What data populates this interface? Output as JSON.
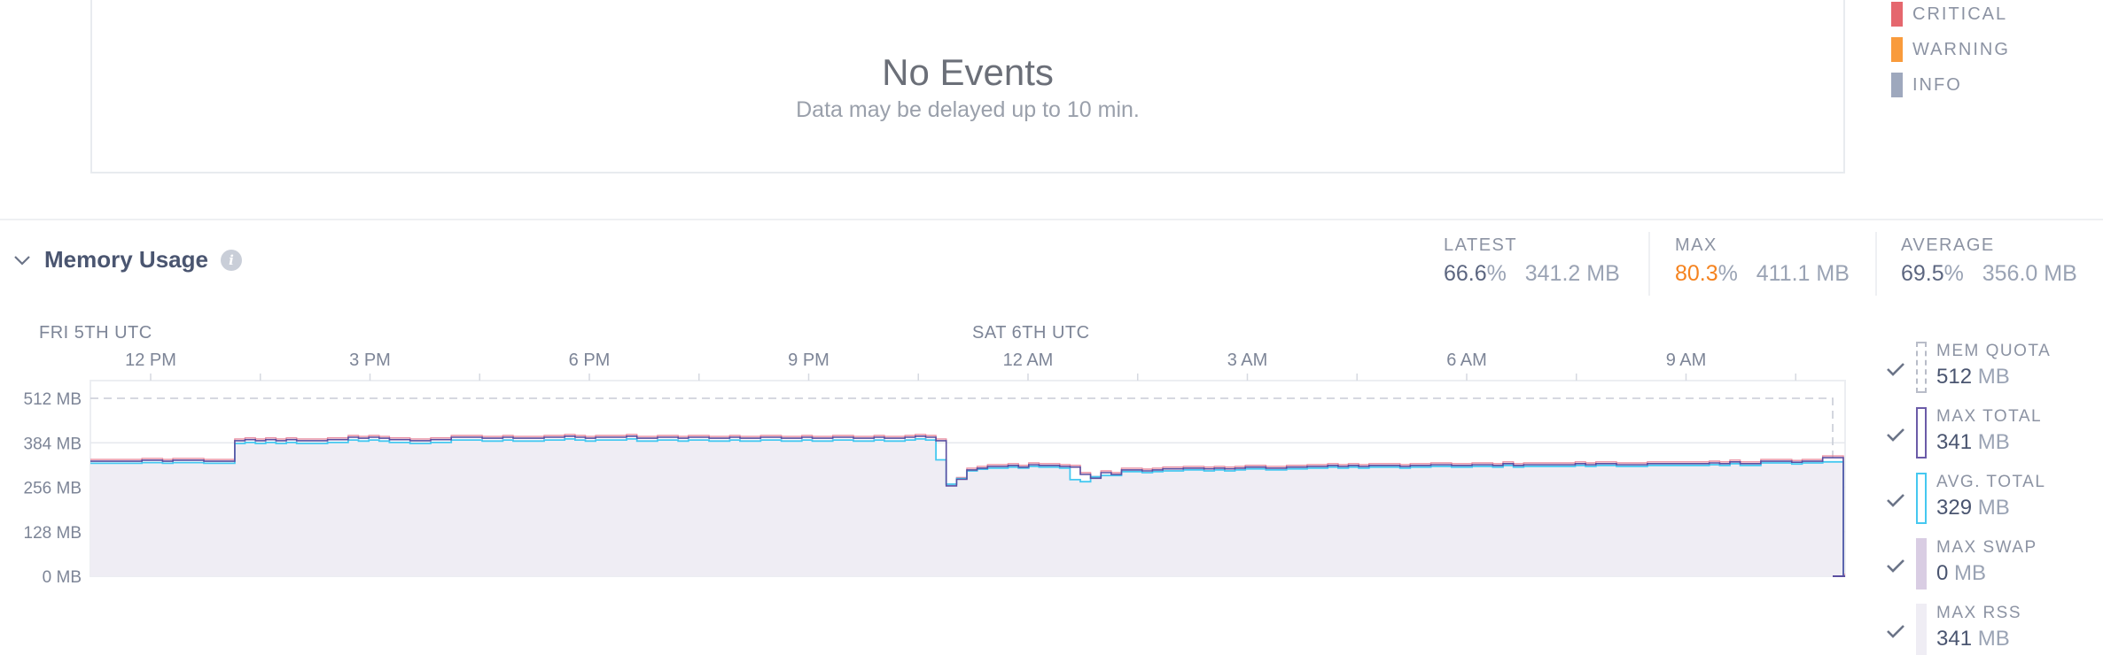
{
  "events": {
    "title": "No Events",
    "subtitle": "Data may be delayed up to 10 min."
  },
  "severity_legend": [
    {
      "label": "CRITICAL",
      "color": "#e5676e"
    },
    {
      "label": "WARNING",
      "color": "#f99b3c"
    },
    {
      "label": "INFO",
      "color": "#9ea8bd"
    }
  ],
  "section": {
    "title": "Memory Usage",
    "info_icon": "i"
  },
  "stats": {
    "latest": {
      "label": "LATEST",
      "pct": "66.6",
      "pct_unit": "%",
      "mb": "341.2 MB"
    },
    "max": {
      "label": "MAX",
      "pct": "80.3",
      "pct_unit": "%",
      "mb": "411.1 MB"
    },
    "average": {
      "label": "AVERAGE",
      "pct": "69.5",
      "pct_unit": "%",
      "mb": "356.0 MB"
    }
  },
  "chart_data": {
    "type": "line",
    "title": "Memory Usage",
    "date_labels": [
      "FRI 5TH UTC",
      "SAT 6TH UTC"
    ],
    "x_tick_labels": [
      "12 PM",
      "3 PM",
      "6 PM",
      "9 PM",
      "12 AM",
      "3 AM",
      "6 AM",
      "9 AM"
    ],
    "y_tick_labels": [
      "512 MB",
      "384 MB",
      "256 MB",
      "128 MB",
      "0 MB"
    ],
    "ylim": [
      0,
      512
    ],
    "x_start": "Fri 10:36",
    "x_step_minutes": 20,
    "grid": true,
    "series": [
      {
        "name": "MEM QUOTA",
        "style": "dashed",
        "color": "#b8bcc8",
        "values": [
          512
        ]
      },
      {
        "name": "MAX TOTAL",
        "color": "#6b5ba8",
        "values": [
          331,
          331,
          331,
          331,
          331,
          334,
          334,
          331,
          334,
          334,
          334,
          331,
          331,
          331,
          390,
          393,
          390,
          393,
          390,
          393,
          390,
          390,
          390,
          393,
          393,
          400,
          397,
          400,
          397,
          393,
          393,
          390,
          390,
          393,
          393,
          400,
          400,
          400,
          397,
          397,
          400,
          397,
          397,
          397,
          400,
          400,
          403,
          400,
          397,
          400,
          400,
          400,
          403,
          397,
          397,
          400,
          400,
          397,
          400,
          400,
          397,
          397,
          400,
          397,
          397,
          400,
          400,
          397,
          397,
          400,
          397,
          397,
          400,
          400,
          397,
          397,
          400,
          397,
          397,
          400,
          403,
          400,
          390,
          260,
          279,
          306,
          311,
          316,
          316,
          319,
          314,
          321,
          319,
          319,
          316,
          314,
          293,
          282,
          298,
          293,
          306,
          306,
          303,
          306,
          309,
          309,
          311,
          311,
          309,
          311,
          309,
          311,
          314,
          314,
          311,
          311,
          314,
          314,
          316,
          316,
          319,
          316,
          319,
          316,
          319,
          319,
          319,
          316,
          319,
          319,
          321,
          321,
          319,
          319,
          321,
          321,
          319,
          324,
          319,
          321,
          321,
          321,
          321,
          321,
          324,
          321,
          324,
          324,
          321,
          321,
          321,
          324,
          324,
          324,
          324,
          324,
          324,
          326,
          324,
          329,
          324,
          324,
          331,
          331,
          331,
          328,
          331,
          331,
          341,
          341,
          0
        ]
      },
      {
        "name": "AVG. TOTAL",
        "color": "#45c8f0",
        "values": [
          325,
          325,
          325,
          325,
          325,
          327,
          327,
          325,
          327,
          327,
          327,
          325,
          325,
          325,
          382,
          385,
          382,
          385,
          382,
          385,
          382,
          382,
          382,
          385,
          385,
          392,
          389,
          392,
          389,
          385,
          385,
          382,
          382,
          385,
          385,
          392,
          392,
          392,
          389,
          389,
          392,
          389,
          389,
          389,
          392,
          392,
          395,
          392,
          389,
          392,
          392,
          392,
          395,
          389,
          389,
          392,
          392,
          389,
          392,
          392,
          389,
          389,
          392,
          389,
          389,
          392,
          392,
          389,
          389,
          392,
          389,
          389,
          392,
          392,
          389,
          389,
          392,
          389,
          389,
          392,
          395,
          392,
          335,
          265,
          281,
          303,
          308,
          311,
          311,
          314,
          311,
          316,
          314,
          314,
          311,
          278,
          272,
          286,
          290,
          290,
          301,
          301,
          298,
          301,
          303,
          303,
          306,
          306,
          303,
          306,
          303,
          306,
          309,
          309,
          306,
          306,
          309,
          309,
          311,
          311,
          314,
          311,
          314,
          311,
          314,
          314,
          314,
          311,
          314,
          314,
          316,
          316,
          314,
          314,
          316,
          316,
          314,
          319,
          314,
          316,
          316,
          316,
          316,
          316,
          319,
          316,
          319,
          319,
          316,
          316,
          316,
          319,
          319,
          319,
          319,
          319,
          319,
          321,
          319,
          324,
          319,
          319,
          326,
          326,
          326,
          323,
          326,
          326,
          329,
          329,
          0
        ]
      },
      {
        "name": "MAX SWAP",
        "color": "#d9cde3",
        "values": [
          0
        ]
      },
      {
        "name": "MAX RSS",
        "color": "#efedf4",
        "values": [
          341
        ]
      }
    ]
  },
  "memory_legend": [
    {
      "name": "MEM QUOTA",
      "value": "512",
      "unit": " MB",
      "color": "#b8bcc8",
      "swatch": "dashed"
    },
    {
      "name": "MAX TOTAL",
      "value": "341",
      "unit": " MB",
      "color": "#6b5ba8",
      "swatch": "outline"
    },
    {
      "name": "AVG. TOTAL",
      "value": "329",
      "unit": " MB",
      "color": "#45c8f0",
      "swatch": "outline"
    },
    {
      "name": "MAX SWAP",
      "value": "0",
      "unit": " MB",
      "color": "#d9cde3",
      "swatch": "fill"
    },
    {
      "name": "MAX RSS",
      "value": "341",
      "unit": " MB",
      "color": "#efedf4",
      "swatch": "fill"
    }
  ]
}
